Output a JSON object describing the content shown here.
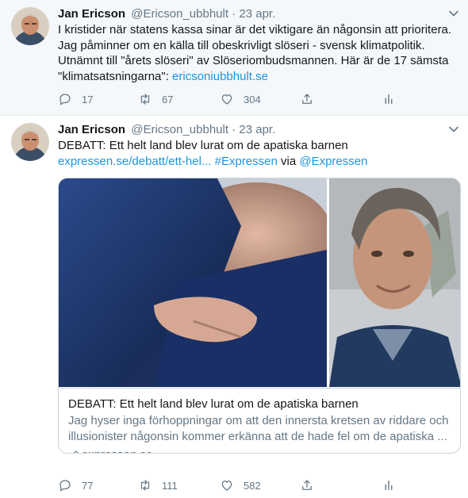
{
  "tweets": [
    {
      "author_name": "Jan Ericson",
      "author_handle": "@Ericson_ubbhult",
      "separator": "·",
      "date": "23 apr.",
      "text_lines": [
        "I kristider när statens kassa sinar är det viktigare än någonsin att prioritera.",
        "Jag påminner om en källa till obeskrivligt slöseri - svensk klimatpolitik.",
        "Utnämnt till \"årets slöseri\" av Slöseriombudsmannen. Här är de 17 sämsta"
      ],
      "text_last_prefix": "\"klimatsatsningarna\": ",
      "text_link": "ericsoniubbhult.se",
      "replies": "17",
      "retweets": "67",
      "likes": "304"
    },
    {
      "author_name": "Jan Ericson",
      "author_handle": "@Ericson_ubbhult",
      "separator": "·",
      "date": "23 apr.",
      "text_line1": "DEBATT: Ett helt land blev lurat om de apatiska barnen",
      "link_url": "expressen.se/debatt/ett-hel...",
      "hashtag": "#Expressen",
      "via_word": " via ",
      "mention": "@Expressen",
      "card": {
        "title": "DEBATT: Ett helt land blev lurat om de apatiska barnen",
        "desc_lines": [
          "Jag hyser inga förhoppningar om att den innersta kretsen av riddare och",
          "illusionister någonsin kommer erkänna att de hade fel om de apatiska ..."
        ],
        "domain": "expressen.se"
      },
      "replies": "77",
      "retweets": "111",
      "likes": "582"
    }
  ],
  "colors": {
    "link": "#1b95e0",
    "secondary": "#657786",
    "text": "#14171a",
    "highlight_bg": "#f5f8fa"
  },
  "icons": [
    "chevron-down-icon",
    "reply-icon",
    "retweet-icon",
    "like-icon",
    "share-icon",
    "analytics-icon",
    "link-icon"
  ]
}
